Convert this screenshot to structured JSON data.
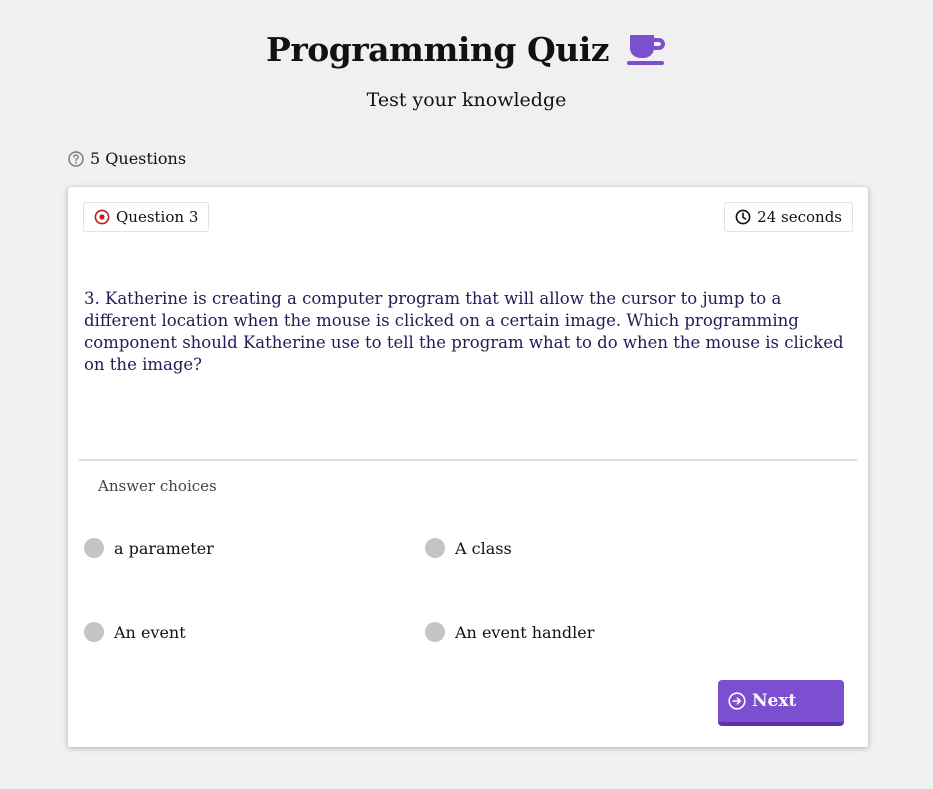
{
  "header": {
    "title": "Programming Quiz",
    "subtitle": "Test your knowledge",
    "title_icon": "coffee-cup-icon"
  },
  "quiz": {
    "question_count_label": "5 Questions",
    "question_label": "Question 3",
    "timer_label": "24 seconds",
    "question_text": "3. Katherine is creating a computer program that will allow the cursor to jump to a different location when the mouse is clicked on a certain image. Which programming component should Katherine use to tell the program what to do when the mouse is clicked on the image?",
    "answers_label": "Answer choices",
    "choices": [
      {
        "label": "a parameter"
      },
      {
        "label": "A class"
      },
      {
        "label": "An event"
      },
      {
        "label": "An event handler"
      }
    ],
    "next_label": "Next"
  },
  "colors": {
    "accent": "#7b4fd0",
    "question_text": "#2a1758",
    "target_icon": "#c21a1a",
    "radio": "#c4c4c4",
    "background": "#f0f0f0"
  }
}
